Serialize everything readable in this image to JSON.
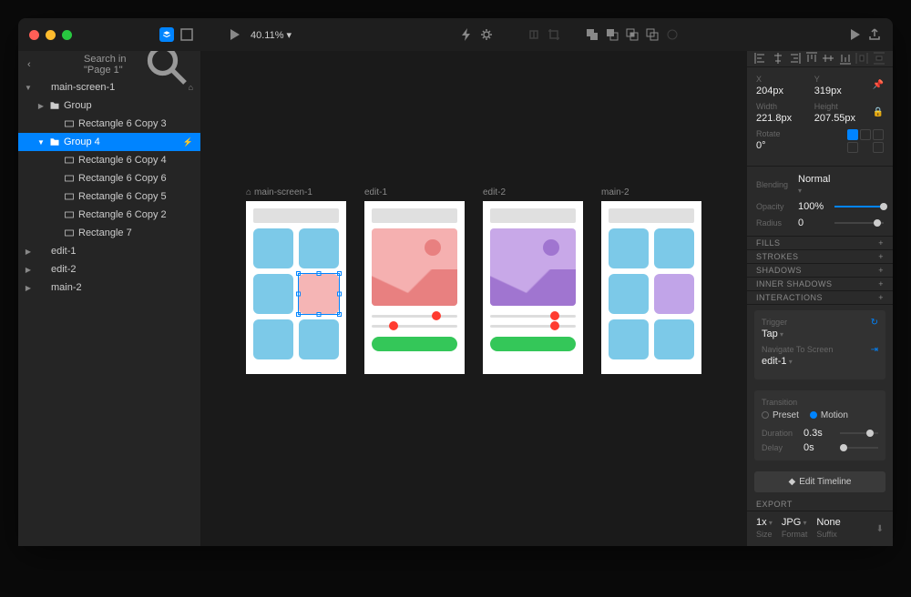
{
  "toolbar": {
    "zoom": "40.11% ▾"
  },
  "leftPanel": {
    "searchLabel": "Search in \"Page 1\"",
    "tree": [
      {
        "label": "main-screen-1",
        "depth": 0,
        "icon": "artboard",
        "disclosure": "▼",
        "end": "⌂"
      },
      {
        "label": "Group",
        "depth": 1,
        "icon": "folder",
        "disclosure": "▶"
      },
      {
        "label": "Rectangle 6 Copy 3",
        "depth": 2,
        "icon": "rect"
      },
      {
        "label": "Group 4",
        "depth": 1,
        "icon": "folder",
        "disclosure": "▼",
        "selected": true,
        "end": "⚡"
      },
      {
        "label": "Rectangle 6 Copy 4",
        "depth": 2,
        "icon": "rect"
      },
      {
        "label": "Rectangle 6 Copy 6",
        "depth": 2,
        "icon": "rect"
      },
      {
        "label": "Rectangle 6 Copy 5",
        "depth": 2,
        "icon": "rect"
      },
      {
        "label": "Rectangle 6 Copy 2",
        "depth": 2,
        "icon": "rect"
      },
      {
        "label": "Rectangle 7",
        "depth": 2,
        "icon": "rect"
      },
      {
        "label": "edit-1",
        "depth": 0,
        "icon": "artboard",
        "disclosure": "▶"
      },
      {
        "label": "edit-2",
        "depth": 0,
        "icon": "artboard",
        "disclosure": "▶"
      },
      {
        "label": "main-2",
        "depth": 0,
        "icon": "artboard",
        "disclosure": "▶"
      }
    ]
  },
  "artboards": [
    {
      "name": "main-screen-1",
      "home": true
    },
    {
      "name": "edit-1"
    },
    {
      "name": "edit-2"
    },
    {
      "name": "main-2"
    }
  ],
  "inspector": {
    "x": {
      "label": "X",
      "value": "204px"
    },
    "y": {
      "label": "Y",
      "value": "319px"
    },
    "width": {
      "label": "Width",
      "value": "221.8px"
    },
    "height": {
      "label": "Height",
      "value": "207.55px"
    },
    "rotate": {
      "label": "Rotate",
      "value": "0°"
    },
    "blending": {
      "label": "Blending",
      "value": "Normal"
    },
    "opacity": {
      "label": "Opacity",
      "value": "100%"
    },
    "radius": {
      "label": "Radius",
      "value": "0"
    },
    "sections": {
      "fills": "FILLS",
      "strokes": "STROKES",
      "shadows": "SHADOWS",
      "innerShadows": "INNER SHADOWS",
      "interactions": "INTERACTIONS",
      "export": "EXPORT"
    },
    "interaction": {
      "trigger": {
        "label": "Trigger",
        "value": "Tap"
      },
      "navigate": {
        "label": "Navigate To Screen",
        "value": "edit-1"
      },
      "transition": {
        "label": "Transition"
      },
      "preset": "Preset",
      "motion": "Motion",
      "duration": {
        "label": "Duration",
        "value": "0.3s"
      },
      "delay": {
        "label": "Delay",
        "value": "0s"
      },
      "editTimeline": "Edit Timeline"
    },
    "export": {
      "size": {
        "label": "Size",
        "value": "1x"
      },
      "format": {
        "label": "Format",
        "value": "JPG"
      },
      "suffix": {
        "label": "Suffix",
        "value": "None"
      }
    }
  }
}
